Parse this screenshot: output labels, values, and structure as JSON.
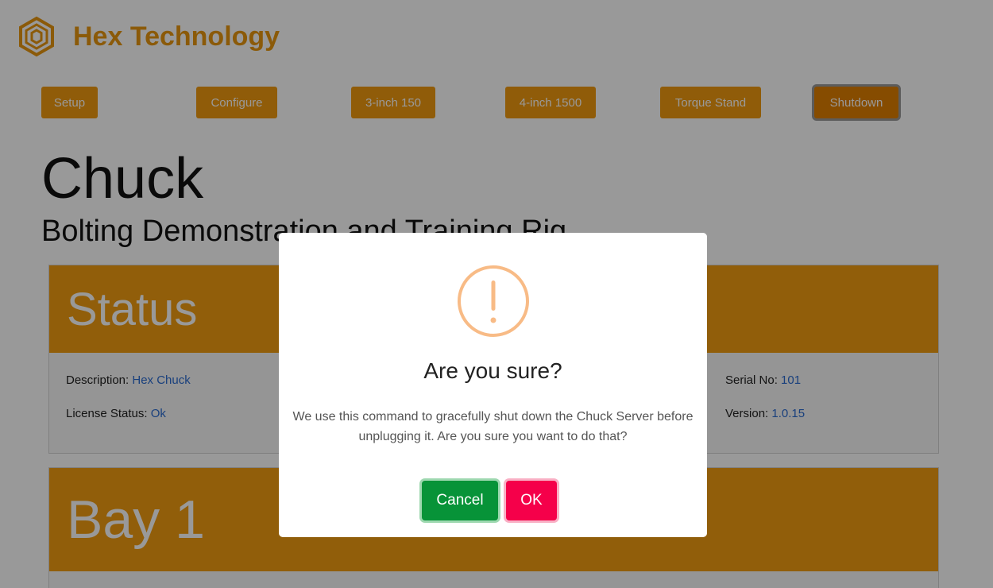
{
  "brand": {
    "name": "Hex Technology"
  },
  "nav": {
    "items": [
      {
        "label": "Setup"
      },
      {
        "label": "Configure"
      },
      {
        "label": "3-inch 150"
      },
      {
        "label": "4-inch 1500"
      },
      {
        "label": "Torque Stand"
      },
      {
        "label": "Shutdown"
      }
    ]
  },
  "page": {
    "title": "Chuck",
    "subtitle": "Bolting Demonstration and Training Rig"
  },
  "status": {
    "header": "Status",
    "description_label": "Description: ",
    "description_value": "Hex Chuck",
    "license_label": "License Status: ",
    "license_value": "Ok",
    "serial_label": "Serial No: ",
    "serial_value": "101",
    "version_label": "Version: ",
    "version_value": "1.0.15"
  },
  "bay": {
    "header": "Bay 1"
  },
  "dialog": {
    "title": "Are you sure?",
    "text": "We use this command to gracefully shut down the Chuck Server before unplugging it. Are you sure you want to do that?",
    "cancel_label": "Cancel",
    "ok_label": "OK",
    "icon": "exclamation-circle-icon"
  },
  "colors": {
    "brand": "#e8970f",
    "nav_button": "#f09a10",
    "card_header": "#f29d12",
    "link": "#2a6bd1",
    "cancel": "#079338",
    "ok": "#f5004a",
    "warning_icon": "#f8bb86"
  }
}
